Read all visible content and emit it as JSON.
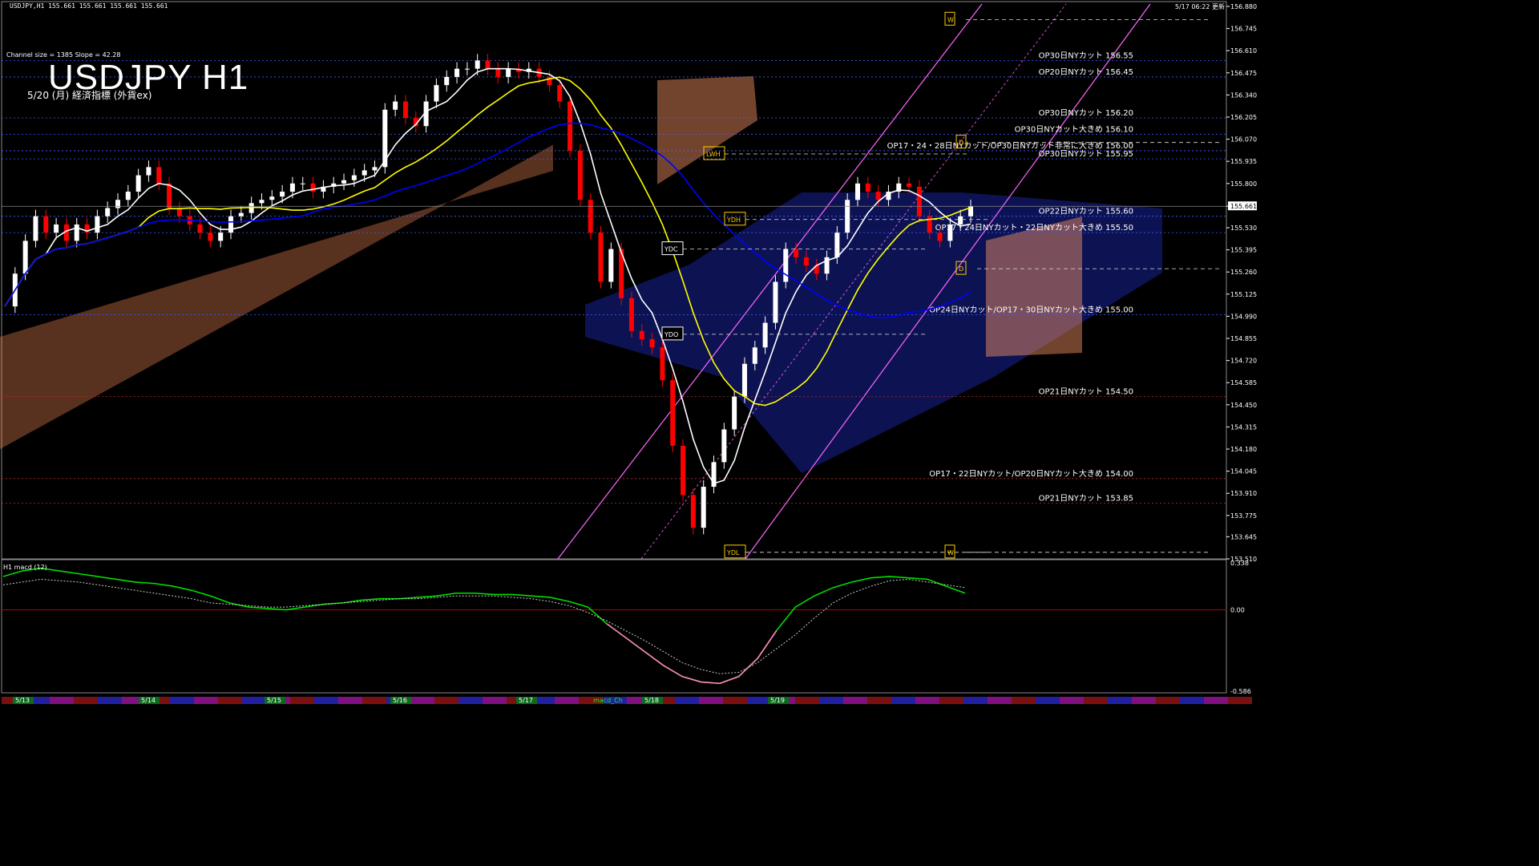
{
  "header": {
    "ohlc_line": "USDJPY,H1  155.661 155.661 155.661 155.661",
    "updated": "5/17 06:22 更新",
    "channel_info": "Channel size = 1385 Slope = 42.28",
    "title": "USDJPY H1",
    "subtitle": "5/20 (月) 経済指標 (外貨ex)"
  },
  "colors": {
    "background": "#000000",
    "grid": "#3a3a3a",
    "axis": "#ffffff",
    "bull_candle": "#ffffff",
    "bear_candle": "#ff0000",
    "ma_white": "#ffffff",
    "ma_yellow": "#ffff00",
    "ma_blue": "#0000ff",
    "cloud_orange": "#ffa070",
    "cloud_blue": "#2040ff",
    "chikou_green": "#00c000",
    "channel_violet": "#ff66ff",
    "cut_line": "#4060ff",
    "macd_main": "#00dd00",
    "macd_neg": "#ff80c0",
    "macd_signal": "#cccccc",
    "price_highlight": "#ffffff"
  },
  "chart_data": {
    "type": "line",
    "symbol": "USDJPY",
    "timeframe": "H1",
    "ylim": [
      153.51,
      156.88
    ],
    "y_ticks": [
      156.88,
      156.745,
      156.61,
      156.475,
      156.34,
      156.205,
      156.07,
      155.935,
      155.8,
      155.661,
      155.53,
      155.395,
      155.26,
      155.125,
      154.99,
      154.855,
      154.72,
      154.585,
      154.45,
      154.315,
      154.18,
      154.045,
      153.91,
      153.775,
      153.645,
      153.51
    ],
    "y_tick_labels": [
      "156.880",
      "156.745",
      "156.610",
      "156.475",
      "156.340",
      "156.205",
      "156.070",
      "155.935",
      "155.800",
      "155.661",
      "155.530",
      "155.395",
      "155.260",
      "155.125",
      "154.990",
      "154.855",
      "154.720",
      "154.585",
      "154.450",
      "154.315",
      "154.180",
      "154.045",
      "153.910",
      "153.775",
      "153.645",
      "153.510"
    ],
    "current_price": 155.661,
    "current_price_label": "155.661",
    "x_labels": [
      "5/13",
      "5/14",
      "5/15",
      "5/16",
      "5/17",
      "5/18",
      "5/19"
    ],
    "cut_levels": [
      {
        "label": "OP30日NYカット 156.55",
        "price": 156.55
      },
      {
        "label": "OP20日NYカット 156.45",
        "price": 156.45
      },
      {
        "label": "OP30日NYカット 156.20",
        "price": 156.2
      },
      {
        "label": "OP30日NYカット大きめ 156.10",
        "price": 156.1
      },
      {
        "label": "OP17・24・28日NYカット/OP30日NYカット非常に大きめ 156.00",
        "price": 156.0
      },
      {
        "label": "OP30日NYカット 155.95",
        "price": 155.95
      },
      {
        "label": "OP22日NYカット 155.60",
        "price": 155.6
      },
      {
        "label": "OP17・24日NYカット・22日NYカット大きめ 155.50",
        "price": 155.5
      },
      {
        "label": "OP24日NYカット/OP17・30日NYカット大きめ 155.00",
        "price": 155.0
      },
      {
        "label": "OP21日NYカット 154.50",
        "price": 154.5
      },
      {
        "label": "OP17・22日NYカット/OP20日NYカット大きめ 154.00",
        "price": 154.0
      },
      {
        "label": "OP21日NYカット 153.85",
        "price": 153.85
      }
    ],
    "markers": [
      {
        "label": "YDC",
        "price": 155.4
      },
      {
        "label": "YDO",
        "price": 154.88
      },
      {
        "label": "YDH",
        "price": 155.58
      },
      {
        "label": "LWH",
        "price": 155.98
      },
      {
        "label": "YDL",
        "price": 153.55
      },
      {
        "label": "W",
        "price": 156.8
      },
      {
        "label": "W",
        "price": 153.55
      },
      {
        "label": "D",
        "price": 156.05
      },
      {
        "label": "D",
        "price": 155.28
      }
    ],
    "close": [
      155.05,
      155.25,
      155.45,
      155.6,
      155.5,
      155.55,
      155.45,
      155.55,
      155.5,
      155.6,
      155.65,
      155.7,
      155.75,
      155.85,
      155.9,
      155.8,
      155.65,
      155.6,
      155.55,
      155.5,
      155.45,
      155.5,
      155.6,
      155.62,
      155.68,
      155.7,
      155.72,
      155.75,
      155.8,
      155.8,
      155.75,
      155.78,
      155.8,
      155.82,
      155.85,
      155.88,
      155.9,
      156.25,
      156.3,
      156.2,
      156.15,
      156.3,
      156.4,
      156.45,
      156.5,
      156.5,
      156.55,
      156.5,
      156.45,
      156.5,
      156.48,
      156.5,
      156.45,
      156.4,
      156.3,
      156.0,
      155.7,
      155.5,
      155.2,
      155.4,
      155.1,
      154.9,
      154.85,
      154.8,
      154.6,
      154.2,
      153.9,
      153.7,
      153.95,
      154.1,
      154.3,
      154.5,
      154.7,
      154.8,
      154.95,
      155.2,
      155.4,
      155.35,
      155.3,
      155.25,
      155.35,
      155.5,
      155.7,
      155.8,
      155.75,
      155.7,
      155.75,
      155.8,
      155.78,
      155.6,
      155.5,
      155.45,
      155.55,
      155.6,
      155.661
    ],
    "macd": {
      "label": "H1  macd (12)",
      "legend": "macd_Ch",
      "ylim": [
        -0.586,
        0.338
      ],
      "y_tick_labels": [
        "0.338",
        "0.00",
        "-0.586"
      ],
      "main": [
        0.24,
        0.28,
        0.3,
        0.28,
        0.26,
        0.24,
        0.22,
        0.2,
        0.19,
        0.17,
        0.14,
        0.1,
        0.05,
        0.02,
        0.01,
        0.0,
        0.02,
        0.04,
        0.05,
        0.07,
        0.08,
        0.08,
        0.09,
        0.1,
        0.12,
        0.12,
        0.11,
        0.11,
        0.1,
        0.09,
        0.06,
        0.02,
        -0.1,
        -0.2,
        -0.3,
        -0.4,
        -0.48,
        -0.52,
        -0.53,
        -0.48,
        -0.35,
        -0.15,
        0.02,
        0.1,
        0.16,
        0.2,
        0.23,
        0.24,
        0.23,
        0.22,
        0.17,
        0.12
      ],
      "signal": [
        0.18,
        0.2,
        0.22,
        0.21,
        0.2,
        0.18,
        0.16,
        0.14,
        0.12,
        0.1,
        0.08,
        0.05,
        0.04,
        0.03,
        0.02,
        0.02,
        0.03,
        0.04,
        0.05,
        0.06,
        0.07,
        0.08,
        0.08,
        0.09,
        0.1,
        0.1,
        0.1,
        0.09,
        0.08,
        0.06,
        0.03,
        -0.02,
        -0.08,
        -0.15,
        -0.22,
        -0.3,
        -0.38,
        -0.43,
        -0.46,
        -0.45,
        -0.38,
        -0.28,
        -0.18,
        -0.06,
        0.05,
        0.12,
        0.17,
        0.21,
        0.22,
        0.2,
        0.18,
        0.16
      ]
    }
  }
}
